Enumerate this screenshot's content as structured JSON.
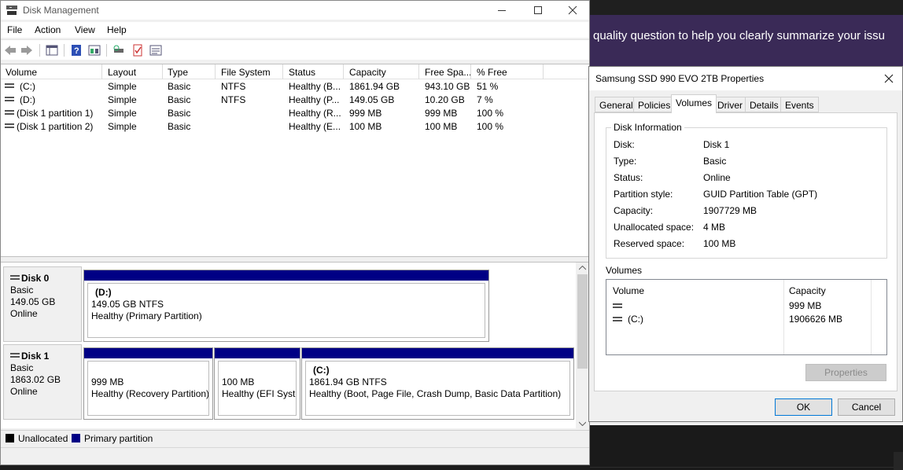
{
  "background": {
    "banner_text": "quality question to help you clearly summarize your issu"
  },
  "dm": {
    "title": "Disk Management",
    "menu": [
      "File",
      "Action",
      "View",
      "Help"
    ],
    "columns": [
      "Volume",
      "Layout",
      "Type",
      "File System",
      "Status",
      "Capacity",
      "Free Spa...",
      "% Free"
    ],
    "rows": [
      {
        "volume": "(C:)",
        "layout": "Simple",
        "type": "Basic",
        "fs": "NTFS",
        "status": "Healthy (B...",
        "capacity": "1861.94 GB",
        "free": "943.10 GB",
        "pct": "51 %"
      },
      {
        "volume": "(D:)",
        "layout": "Simple",
        "type": "Basic",
        "fs": "NTFS",
        "status": "Healthy (P...",
        "capacity": "149.05 GB",
        "free": "10.20 GB",
        "pct": "7 %"
      },
      {
        "volume": "(Disk 1 partition 1)",
        "layout": "Simple",
        "type": "Basic",
        "fs": "",
        "status": "Healthy (R...",
        "capacity": "999 MB",
        "free": "999 MB",
        "pct": "100 %"
      },
      {
        "volume": "(Disk 1 partition 2)",
        "layout": "Simple",
        "type": "Basic",
        "fs": "",
        "status": "Healthy (E...",
        "capacity": "100 MB",
        "free": "100 MB",
        "pct": "100 %"
      }
    ],
    "disks": [
      {
        "name": "Disk 0",
        "type": "Basic",
        "size": "149.05 GB",
        "state": "Online",
        "partitions": [
          {
            "label": "(D:)",
            "size": "149.05 GB NTFS",
            "status": "Healthy (Primary Partition)"
          }
        ]
      },
      {
        "name": "Disk 1",
        "type": "Basic",
        "size": "1863.02 GB",
        "state": "Online",
        "partitions": [
          {
            "label": "",
            "size": "999 MB",
            "status": "Healthy (Recovery Partition)"
          },
          {
            "label": "",
            "size": "100 MB",
            "status": "Healthy (EFI Syster"
          },
          {
            "label": "(C:)",
            "size": "1861.94 GB NTFS",
            "status": "Healthy (Boot, Page File, Crash Dump, Basic Data Partition)"
          }
        ]
      }
    ],
    "legend": [
      {
        "label": "Unallocated",
        "color": "#000000"
      },
      {
        "label": "Primary partition",
        "color": "#000085"
      }
    ]
  },
  "props": {
    "title": "Samsung SSD 990 EVO 2TB Properties",
    "tabs": [
      "General",
      "Policies",
      "Volumes",
      "Driver",
      "Details",
      "Events"
    ],
    "active_tab": "Volumes",
    "disk_info_title": "Disk Information",
    "info": [
      {
        "k": "Disk:",
        "v": "Disk 1"
      },
      {
        "k": "Type:",
        "v": "Basic"
      },
      {
        "k": "Status:",
        "v": "Online"
      },
      {
        "k": "Partition style:",
        "v": "GUID Partition Table (GPT)"
      },
      {
        "k": "Capacity:",
        "v": "1907729 MB"
      },
      {
        "k": "Unallocated space:",
        "v": "4 MB"
      },
      {
        "k": "Reserved space:",
        "v": "100 MB"
      }
    ],
    "volumes_title": "Volumes",
    "vol_headers": [
      "Volume",
      "Capacity"
    ],
    "volumes": [
      {
        "name": "",
        "capacity": "999 MB"
      },
      {
        "name": "(C:)",
        "capacity": "1906626 MB"
      }
    ],
    "properties_btn": "Properties",
    "ok_btn": "OK",
    "cancel_btn": "Cancel"
  }
}
